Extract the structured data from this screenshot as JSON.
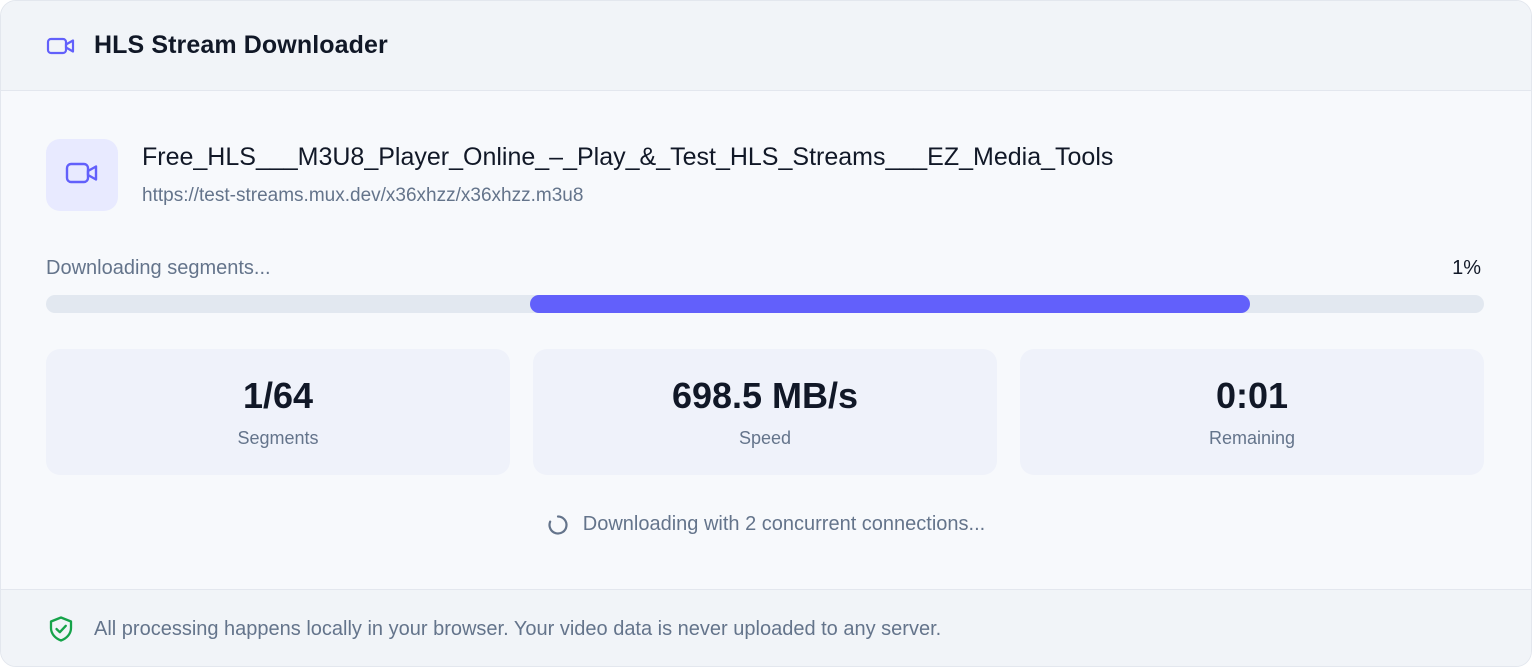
{
  "header": {
    "title": "HLS Stream Downloader",
    "icon": "video-camera-icon"
  },
  "file": {
    "icon": "video-camera-icon",
    "name": "Free_HLS___M3U8_Player_Online_–_Play_&_Test_HLS_Streams___EZ_Media_Tools",
    "url": "https://test-streams.mux.dev/x36xhzz/x36xhzz.m3u8"
  },
  "progress": {
    "label": "Downloading segments...",
    "percent_text": "1%"
  },
  "stats": [
    {
      "value": "1/64",
      "label": "Segments"
    },
    {
      "value": "698.5 MB/s",
      "label": "Speed"
    },
    {
      "value": "0:01",
      "label": "Remaining"
    }
  ],
  "status": {
    "icon": "spinner-icon",
    "text": "Downloading with 2 concurrent connections..."
  },
  "footer": {
    "icon": "shield-check-icon",
    "text": "All processing happens locally in your browser. Your video data is never uploaded to any server."
  },
  "colors": {
    "accent": "#6260fb",
    "track": "#e2e8f0",
    "shield_green": "#16a34a",
    "text_primary": "#111827",
    "text_secondary": "#64748b"
  }
}
